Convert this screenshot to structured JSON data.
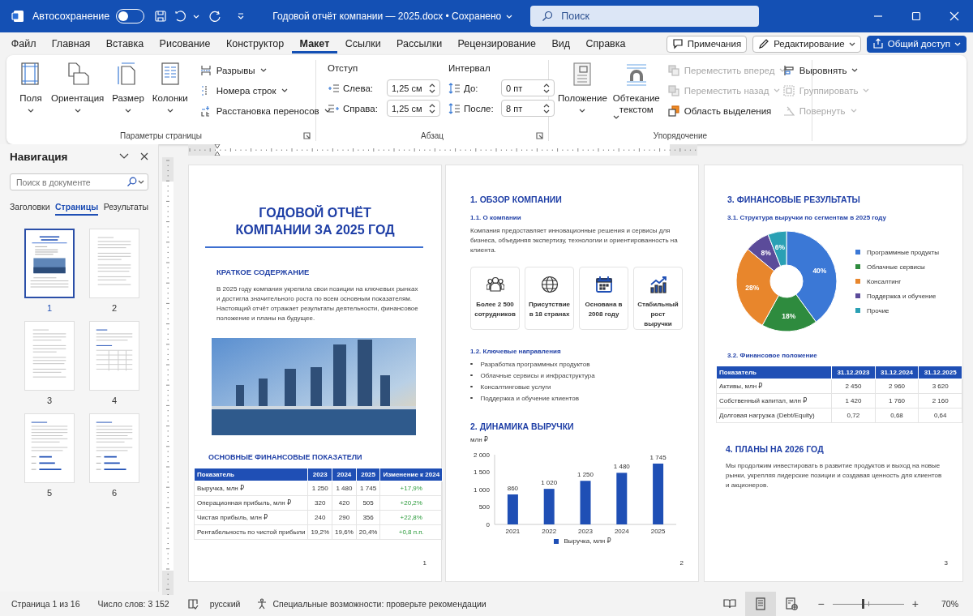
{
  "title_bar": {
    "autosave_label": "Автосохранение",
    "autosave_on": false,
    "document_title": "Годовой отчёт компании — 2025.docx • Сохранено",
    "search_placeholder": "Поиск"
  },
  "ribbon_tabs": [
    {
      "label": "Файл",
      "selected": false
    },
    {
      "label": "Главная",
      "selected": false
    },
    {
      "label": "Вставка",
      "selected": false
    },
    {
      "label": "Рисование",
      "selected": false
    },
    {
      "label": "Конструктор",
      "selected": false
    },
    {
      "label": "Макет",
      "selected": true
    },
    {
      "label": "Ссылки",
      "selected": false
    },
    {
      "label": "Рассылки",
      "selected": false
    },
    {
      "label": "Рецензирование",
      "selected": false
    },
    {
      "label": "Вид",
      "selected": false
    },
    {
      "label": "Справка",
      "selected": false
    }
  ],
  "header_buttons": [
    {
      "label": "Примечания",
      "kind": "comments"
    },
    {
      "label": "Редактирование",
      "kind": "editing"
    },
    {
      "label": "Общий доступ",
      "kind": "share"
    }
  ],
  "page_setup": {
    "large_buttons": [
      {
        "label": "Поля",
        "kind": "margins"
      },
      {
        "label": "Ориентация",
        "kind": "orientation"
      },
      {
        "label": "Размер",
        "kind": "size"
      },
      {
        "label": "Колонки",
        "kind": "columns"
      }
    ],
    "small_buttons": [
      {
        "label": "Разрывы",
        "kind": "breaks"
      },
      {
        "label": "Номера строк",
        "kind": "line-numbers"
      },
      {
        "label": "Расстановка переносов",
        "kind": "hyphenation"
      }
    ],
    "group_label": "Параметры страницы"
  },
  "paragraph": {
    "indent_label": "Отступ",
    "spacing_label": "Интервал",
    "indent_fields": [
      {
        "label": "Слева:",
        "value": "1,25 см"
      },
      {
        "label": "Справа:",
        "value": "1,25 см"
      }
    ],
    "spacing_fields": [
      {
        "label": "До:",
        "value": "0 пт"
      },
      {
        "label": "После:",
        "value": "8 пт"
      }
    ],
    "group_label": "Абзац"
  },
  "arrange": {
    "large_buttons": [
      {
        "label": "Положение",
        "kind": "position"
      },
      {
        "label": "Обтекание текстом",
        "kind": "wrap"
      }
    ],
    "commands": [
      {
        "label": "Переместить вперед",
        "kind": "forward",
        "disabled": true,
        "dropdown": true
      },
      {
        "label": "Переместить назад",
        "kind": "backward",
        "disabled": true,
        "dropdown": true
      },
      {
        "label": "Область выделения",
        "kind": "selection",
        "disabled": false,
        "dropdown": false
      },
      {
        "label": "Выровнять",
        "kind": "align",
        "disabled": false,
        "dropdown": true
      },
      {
        "label": "Группировать",
        "kind": "group",
        "disabled": true,
        "dropdown": true
      },
      {
        "label": "Повернуть",
        "kind": "rotate",
        "disabled": true,
        "dropdown": true
      }
    ],
    "group_label": "Упорядочение"
  },
  "nav": {
    "title": "Навигация",
    "search_placeholder": "Поиск в документе",
    "tabs": [
      {
        "label": "Заголовки",
        "selected": false
      },
      {
        "label": "Страницы",
        "selected": true
      },
      {
        "label": "Результаты",
        "selected": false
      }
    ],
    "pages": [
      {
        "number": "1",
        "kind": "cover",
        "selected": true
      },
      {
        "number": "2",
        "kind": "text",
        "selected": false
      },
      {
        "number": "3",
        "kind": "text",
        "selected": false
      },
      {
        "number": "4",
        "kind": "table",
        "selected": false
      },
      {
        "number": "5",
        "kind": "bars",
        "selected": false
      },
      {
        "number": "6",
        "kind": "bars",
        "selected": false
      }
    ]
  },
  "page1": {
    "title_lines": [
      "ГОДОВОЙ ОТЧЁТ",
      "КОМПАНИИ ЗА 2025 ГОД"
    ],
    "summary_heading": "КРАТКОЕ СОДЕРЖАНИЕ",
    "summary_text": "В 2025 году компания укрепила свои позиции на ключевых рынках и достигла значительного роста по всем основным показателям. Настоящий отчёт отражает результаты деятельности, финансовое положение и планы на будущее.",
    "indicators_heading": "ОСНОВНЫЕ ФИНАНСОВЫЕ ПОКАЗАТЕЛИ",
    "table": {
      "columns": [
        "Показатель",
        "2023",
        "2024",
        "2025",
        "Изменение к 2024"
      ],
      "rows": [
        [
          "Выручка, млн ₽",
          "1 250",
          "1 480",
          "1 745",
          "+17,9%"
        ],
        [
          "Операционная прибыль, млн ₽",
          "320",
          "420",
          "505",
          "+20,2%"
        ],
        [
          "Чистая прибыль, млн ₽",
          "240",
          "290",
          "356",
          "+22,8%"
        ],
        [
          "Рентабельность по чистой прибыли",
          "19,2%",
          "19,6%",
          "20,4%",
          "+0,8 п.п."
        ]
      ]
    },
    "page_number": "1"
  },
  "page2": {
    "heading": "1. ОБЗОР КОМПАНИИ",
    "about_heading": "1.1. О компании",
    "about_text": "Компания предоставляет инновационные решения и сервисы для бизнеса, объединяя экспертизу, технологии и ориентированность на клиента.",
    "cards": [
      {
        "kind": "people",
        "text": "Более 2 500 сотрудников"
      },
      {
        "kind": "globe",
        "text": "Присутствие в 18 странах"
      },
      {
        "kind": "calendar",
        "text": "Основана в 2008 году"
      },
      {
        "kind": "growth",
        "text": "Стабильный рост выручки"
      }
    ],
    "directions_heading": "1.2. Ключевые направления",
    "directions": [
      "Разработка программных продуктов",
      "Облачные сервисы и инфраструктура",
      "Консалтинговые услуги",
      "Поддержка и обучение клиентов"
    ],
    "revenue_heading": "2. ДИНАМИКА ВЫРУЧКИ",
    "chart_data": {
      "type": "bar",
      "ylabel": "млн ₽",
      "categories": [
        "2021",
        "2022",
        "2023",
        "2024",
        "2025"
      ],
      "series": [
        {
          "name": "Выручка, млн ₽",
          "color": "#1f4fb5",
          "values": [
            860,
            1020,
            1250,
            1480,
            1745
          ]
        }
      ],
      "legend": "bottom",
      "ylim": [
        0,
        2000
      ],
      "yticks": [
        {
          "value": 0,
          "label": "0"
        },
        {
          "value": 500,
          "label": "500"
        },
        {
          "value": 1000,
          "label": "1 000"
        },
        {
          "value": 1500,
          "label": "1 500"
        },
        {
          "value": 2000,
          "label": "2 000"
        }
      ],
      "value_labels": [
        "860",
        "1 020",
        "1 250",
        "1 480",
        "1 745"
      ]
    },
    "page_number": "2"
  },
  "page3": {
    "heading": "3. ФИНАНСОВЫЕ РЕЗУЛЬТАТЫ",
    "structure_heading": "3.1. Структура выручки по сегментам в 2025 году",
    "chart_data": {
      "type": "donut",
      "categories": [
        "Программные продукты",
        "Облачные сервисы",
        "Консалтинг",
        "Поддержка и обучение",
        "Прочие"
      ],
      "values": [
        40,
        18,
        28,
        8,
        6
      ],
      "colors": [
        "#3b78d6",
        "#2e8b3e",
        "#e8862c",
        "#5b4b9a",
        "#2aa0b4"
      ],
      "legend": "right",
      "value_labels": [
        "40%",
        "18%",
        "28%",
        "8%",
        "6%"
      ]
    },
    "position_heading": "3.2. Финансовое положение",
    "table": {
      "columns": [
        "Показатель",
        "31.12.2023",
        "31.12.2024",
        "31.12.2025"
      ],
      "rows": [
        [
          "Активы, млн ₽",
          "2 450",
          "2 960",
          "3 620"
        ],
        [
          "Собственный капитал, млн ₽",
          "1 420",
          "1 760",
          "2 160"
        ],
        [
          "Долговая нагрузка (Debt/Equity)",
          "0,72",
          "0,68",
          "0,64"
        ]
      ]
    },
    "plans_heading": "4. ПЛАНЫ НА 2026 ГОД",
    "plans_text": "Мы продолжим инвестировать в развитие продуктов и выход на новые рынки, укрепляя лидерские позиции и создавая ценность для клиентов и акционеров.",
    "page_number": "3"
  },
  "status_bar": {
    "page": "Страница 1 из 16",
    "words": "Число слов: 3 152",
    "language": "русский",
    "accessibility": "Специальные возможности: проверьте рекомендации",
    "views": [
      {
        "kind": "read",
        "selected": false
      },
      {
        "kind": "print",
        "selected": true
      },
      {
        "kind": "web",
        "selected": false
      }
    ],
    "zoom": {
      "minus": "−",
      "plus": "+",
      "level": 0.42,
      "reading": "70%"
    }
  }
}
